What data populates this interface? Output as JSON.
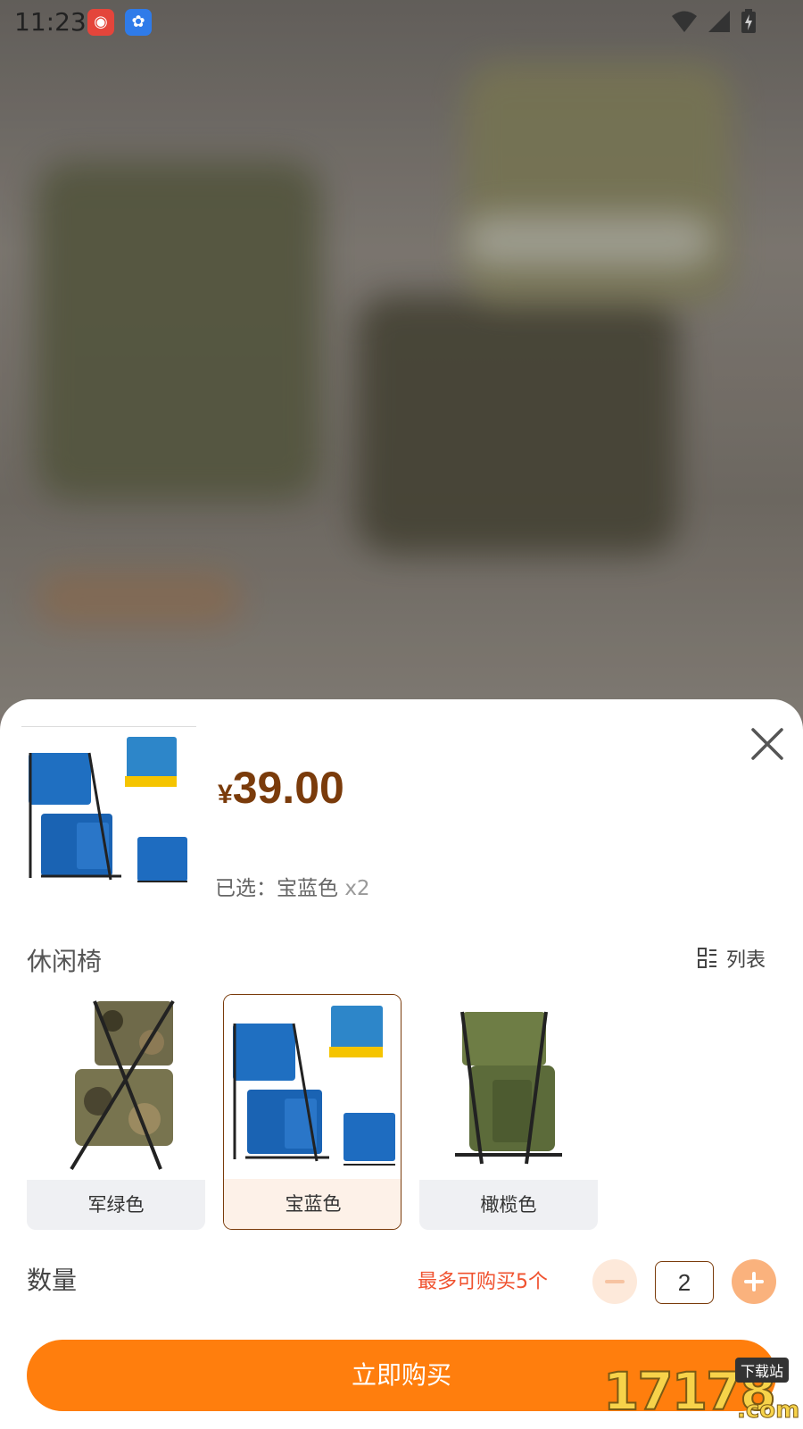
{
  "status_bar": {
    "time": "11:23"
  },
  "product": {
    "price_currency": "¥",
    "price": "39.00",
    "selected_prefix": "已选：",
    "selected_value": "宝蓝色",
    "selected_qty": "x2"
  },
  "category": {
    "label": "休闲椅",
    "view_toggle_label": "列表"
  },
  "options": [
    {
      "label": "军绿色",
      "selected": false
    },
    {
      "label": "宝蓝色",
      "selected": true
    },
    {
      "label": "橄榄色",
      "selected": false
    }
  ],
  "quantity": {
    "label": "数量",
    "limit_text": "最多可购买5个",
    "value": "2"
  },
  "buy_button": {
    "label": "立即购买"
  },
  "watermark": {
    "number": "17178",
    "tag": "下载站",
    "suffix": ".com"
  },
  "colors": {
    "accent": "#ff7e0d",
    "price": "#7a3b0b",
    "limit": "#f0522f"
  }
}
